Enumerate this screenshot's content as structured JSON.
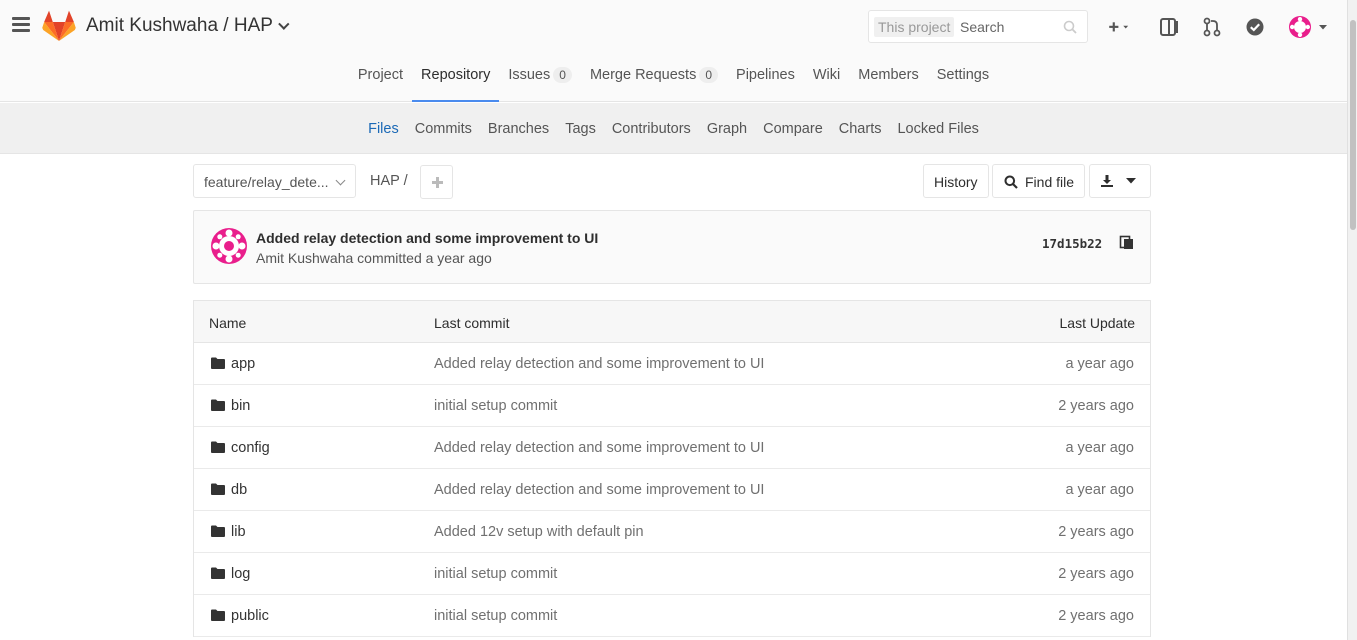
{
  "header": {
    "project_title": "Amit Kushwaha / HAP",
    "search_scope": "This project",
    "search_placeholder": "Search"
  },
  "project_nav": [
    {
      "label": "Project"
    },
    {
      "label": "Repository",
      "active": true
    },
    {
      "label": "Issues",
      "count": "0"
    },
    {
      "label": "Merge Requests",
      "count": "0"
    },
    {
      "label": "Pipelines"
    },
    {
      "label": "Wiki"
    },
    {
      "label": "Members"
    },
    {
      "label": "Settings"
    }
  ],
  "sub_nav": [
    {
      "label": "Files",
      "active": true
    },
    {
      "label": "Commits"
    },
    {
      "label": "Branches"
    },
    {
      "label": "Tags"
    },
    {
      "label": "Contributors"
    },
    {
      "label": "Graph"
    },
    {
      "label": "Compare"
    },
    {
      "label": "Charts"
    },
    {
      "label": "Locked Files"
    }
  ],
  "toolbar": {
    "branch": "feature/relay_dete...",
    "breadcrumb": "HAP  /",
    "history_label": "History",
    "find_file_label": "Find file"
  },
  "last_commit": {
    "title": "Added relay detection and some improvement to UI",
    "meta": "Amit Kushwaha committed a year ago",
    "sha": "17d15b22"
  },
  "table": {
    "headers": {
      "name": "Name",
      "last_commit": "Last commit",
      "last_update": "Last Update"
    },
    "rows": [
      {
        "name": "app",
        "commit": "Added relay detection and some improvement to UI",
        "updated": "a year ago"
      },
      {
        "name": "bin",
        "commit": "initial setup commit",
        "updated": "2 years ago"
      },
      {
        "name": "config",
        "commit": "Added relay detection and some improvement to UI",
        "updated": "a year ago"
      },
      {
        "name": "db",
        "commit": "Added relay detection and some improvement to UI",
        "updated": "a year ago"
      },
      {
        "name": "lib",
        "commit": "Added 12v setup with default pin",
        "updated": "2 years ago"
      },
      {
        "name": "log",
        "commit": "initial setup commit",
        "updated": "2 years ago"
      },
      {
        "name": "public",
        "commit": "initial setup commit",
        "updated": "2 years ago"
      }
    ]
  },
  "colors": {
    "accent": "#4a8bee",
    "active_link": "#1b69b6",
    "avatar_pink": "#e91e8c",
    "logo_orange": "#e24329"
  }
}
